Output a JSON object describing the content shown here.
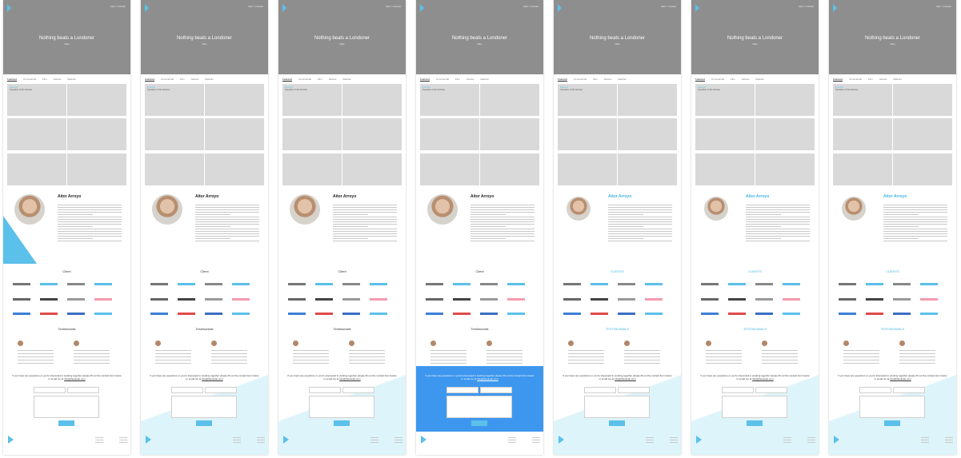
{
  "hero": {
    "title": "Nothing beats a Londoner",
    "subtitle": "Nike",
    "nav": "Aitor / Contact"
  },
  "tabs": [
    "Featured",
    "Commercial",
    "Film",
    "Games",
    "Medium"
  ],
  "tile_caption": {
    "tag": "Featured",
    "title": "Operation of Alo Gloriosa"
  },
  "bio": {
    "name": "Aitor Arroyo"
  },
  "sections": {
    "clients": "Client",
    "clients_alt": "CLIENTS",
    "testimonials": "Testimonials",
    "testimonials_alt": "TESTIMONIALS"
  },
  "contact": {
    "text": "If you have any questions or you're interested in working together please fill out the contact form below or email me at",
    "email": "info@thestudio.com"
  },
  "colors": {
    "accent": "#5bc0ea",
    "blue": "#3e97ee",
    "hero": "#8e8e8e",
    "tile": "#d9d9d9"
  }
}
